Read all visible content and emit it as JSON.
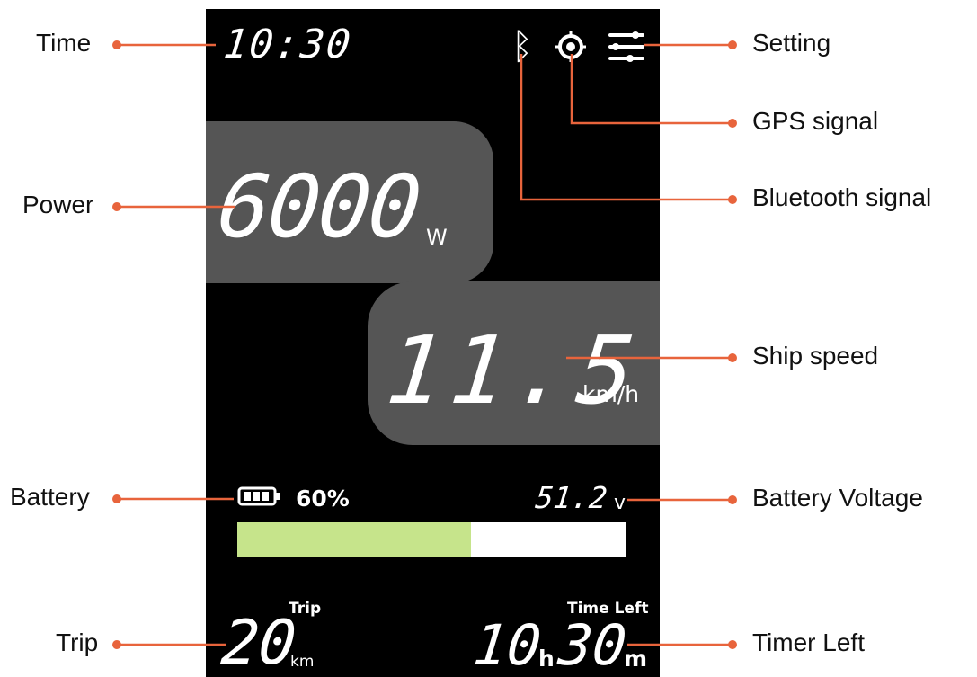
{
  "display": {
    "time": "10:30",
    "power": {
      "value": "6000",
      "unit": "W"
    },
    "speed": {
      "value": "11.5",
      "unit": "km/h"
    },
    "battery": {
      "percent_text": "60%",
      "fill_fraction": 0.6
    },
    "voltage": {
      "value": "51.2",
      "unit": "v"
    },
    "trip": {
      "label": "Trip",
      "value": "20",
      "unit": "km"
    },
    "time_left": {
      "label": "Time Left",
      "hours": "10",
      "hours_unit": "h",
      "minutes": "30",
      "minutes_unit": "m"
    },
    "icons": {
      "bluetooth": "bluetooth-icon",
      "gps": "gps-icon",
      "settings": "settings-icon"
    }
  },
  "callouts": {
    "time": "Time",
    "power": "Power",
    "battery": "Battery",
    "trip": "Trip",
    "setting": "Setting",
    "gps_signal": "GPS signal",
    "bluetooth_signal": "Bluetooth signal",
    "ship_speed": "Ship speed",
    "battery_voltage": "Battery Voltage",
    "timer_left": "Timer Left"
  },
  "colors": {
    "accent": "#e8643c",
    "panel": "#555555",
    "screen": "#000000",
    "battery_fill": "#c6e48b"
  }
}
